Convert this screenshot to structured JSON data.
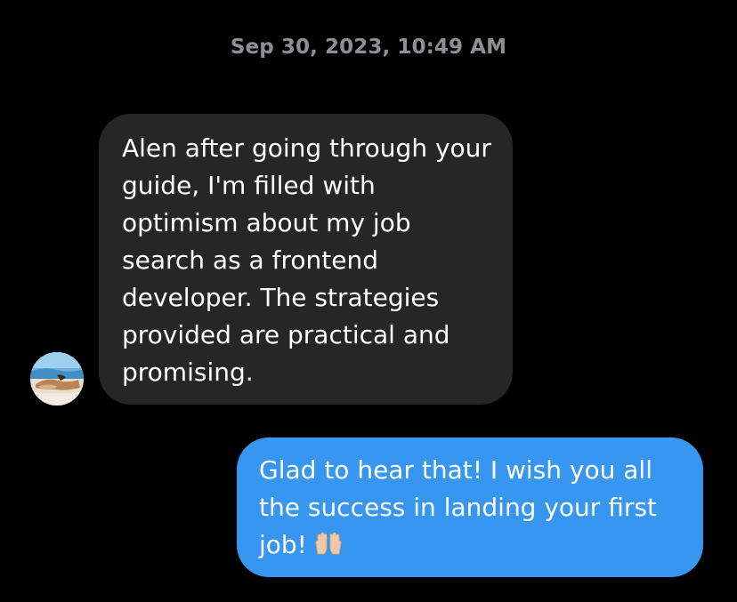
{
  "thread": {
    "timestamp": "Sep 30, 2023, 10:49 AM"
  },
  "messages": [
    {
      "sender": "other",
      "text": "Alen after going through your guide, I'm filled with optimism about my job search as a frontend developer. The strategies provided are practical and promising."
    },
    {
      "sender": "self",
      "text": "Glad to hear that! I wish you all the success in landing your first job!",
      "emoji": "raising-hands-icon"
    }
  ],
  "colors": {
    "background": "#000000",
    "incoming_bubble": "#262626",
    "outgoing_bubble": "#3797f0",
    "timestamp": "#8e8e93",
    "text": "#ffffff"
  }
}
